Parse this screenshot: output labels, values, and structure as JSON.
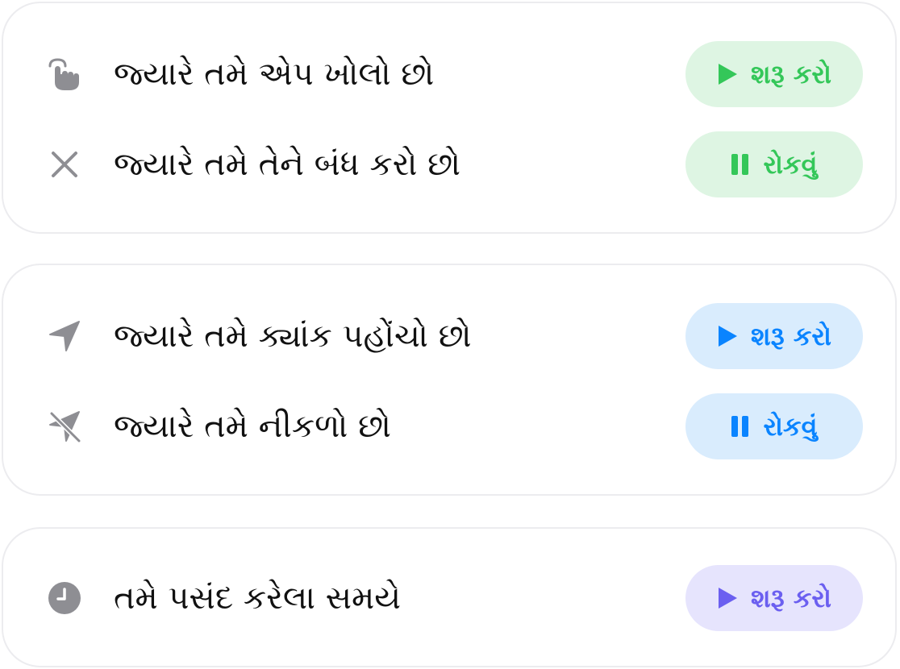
{
  "colors": {
    "green": "#34c759",
    "blue": "#0a84ff",
    "purple": "#6b5ff0",
    "icon_gray": "#8e8e93"
  },
  "groups": [
    {
      "rows": [
        {
          "icon": "hand-tap-icon",
          "label": "જ્યારે તમે એપ ખોલો છો",
          "button": {
            "icon": "play-icon",
            "label": "શરૂ કરો"
          }
        },
        {
          "icon": "close-icon",
          "label": "જ્યારે તમે તેને બંધ કરો છો",
          "button": {
            "icon": "pause-icon",
            "label": "રોકવું"
          }
        }
      ]
    },
    {
      "rows": [
        {
          "icon": "location-arrow-icon",
          "label": "જ્યારે તમે ક્યાંક પહોંચો છો",
          "button": {
            "icon": "play-icon",
            "label": "શરૂ કરો"
          }
        },
        {
          "icon": "location-off-icon",
          "label": "જ્યારે તમે નીકળો છો",
          "button": {
            "icon": "pause-icon",
            "label": "રોકવું"
          }
        }
      ]
    },
    {
      "rows": [
        {
          "icon": "clock-icon",
          "label": "તમે પસંદ કરેલા સમયે",
          "button": {
            "icon": "play-icon",
            "label": "શરૂ કરો"
          }
        }
      ]
    }
  ]
}
